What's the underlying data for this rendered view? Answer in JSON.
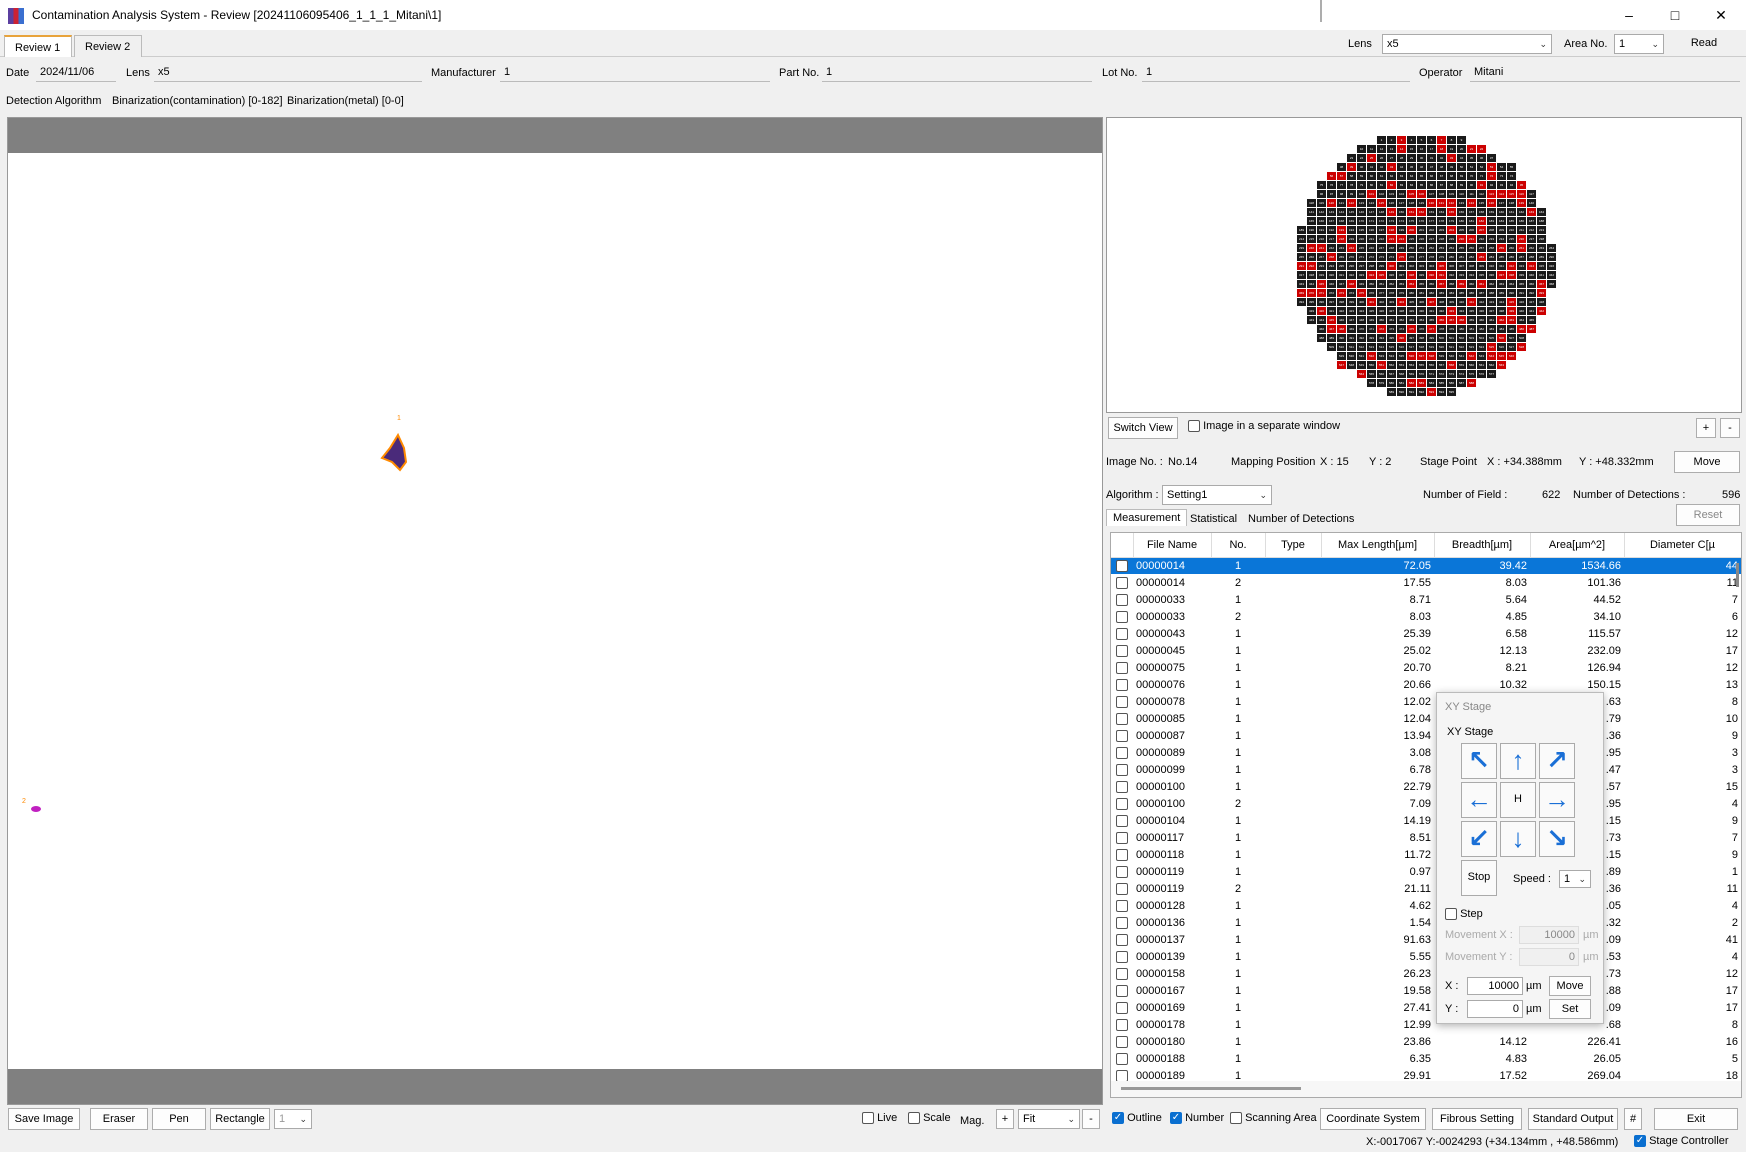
{
  "window": {
    "title": "Contamination Analysis System - Review [20241106095406_1_1_1_Mitani\\1]"
  },
  "tabs": [
    "Review 1",
    "Review 2"
  ],
  "topright": {
    "lens_label": "Lens",
    "lens_value": "x5",
    "area_label": "Area No.",
    "area_value": "1",
    "read_label": "Read"
  },
  "info": {
    "date_label": "Date",
    "date": "2024/11/06",
    "lens_label": "Lens",
    "lens": "x5",
    "manufacturer_label": "Manufacturer",
    "manufacturer": "1",
    "partno_label": "Part No.",
    "partno": "1",
    "lotno_label": "Lot No.",
    "lotno": "1",
    "operator_label": "Operator",
    "operator": "Mitani"
  },
  "detection": {
    "label": "Detection Algorithm",
    "value1": "Binarization(contamination) [0-182]",
    "value2": "Binarization(metal) [0-0]"
  },
  "image": {
    "particle1_label": "1",
    "particle2_label": "2"
  },
  "mapctrl": {
    "switch_view": "Switch View",
    "separate_window": "Image in a separate window",
    "plus": "+",
    "minus": "-"
  },
  "position": {
    "image_no_label": "Image No. :",
    "image_no": "No.14",
    "mapping_label": "Mapping Position",
    "mapping_x": "X : 15",
    "mapping_y": "Y : 2",
    "stage_label": "Stage Point",
    "stage_x": "X : +34.388mm",
    "stage_y": "Y : +48.332mm",
    "move": "Move"
  },
  "algorithm": {
    "label": "Algorithm :",
    "value": "Setting1",
    "fields_label": "Number of Field :",
    "fields": "622",
    "detections_label": "Number of Detections :",
    "detections": "596",
    "reset": "Reset"
  },
  "subtabs": [
    "Measurement",
    "Statistical",
    "Number of Detections"
  ],
  "table": {
    "headers": [
      "File Name",
      "No.",
      "Type",
      "Max Length[µm]",
      "Breadth[µm]",
      "Area[µm^2]",
      "Diameter C[µ"
    ],
    "rows": [
      [
        "00000014",
        "1",
        "",
        "72.05",
        "39.42",
        "1534.66",
        "44"
      ],
      [
        "00000014",
        "2",
        "",
        "17.55",
        "8.03",
        "101.36",
        "11"
      ],
      [
        "00000033",
        "1",
        "",
        "8.71",
        "5.64",
        "44.52",
        "7"
      ],
      [
        "00000033",
        "2",
        "",
        "8.03",
        "4.85",
        "34.10",
        "6"
      ],
      [
        "00000043",
        "1",
        "",
        "25.39",
        "6.58",
        "115.57",
        "12"
      ],
      [
        "00000045",
        "1",
        "",
        "25.02",
        "12.13",
        "232.09",
        "17"
      ],
      [
        "00000075",
        "1",
        "",
        "20.70",
        "8.21",
        "126.94",
        "12"
      ],
      [
        "00000076",
        "1",
        "",
        "20.66",
        "10.32",
        "150.15",
        "13"
      ],
      [
        "00000078",
        "1",
        "",
        "12.02",
        "",
        ".63",
        "8"
      ],
      [
        "00000085",
        "1",
        "",
        "12.04",
        "",
        ".79",
        "10"
      ],
      [
        "00000087",
        "1",
        "",
        "13.94",
        "",
        ".36",
        "9"
      ],
      [
        "00000089",
        "1",
        "",
        "3.08",
        "",
        ".95",
        "3"
      ],
      [
        "00000099",
        "1",
        "",
        "6.78",
        "",
        ".47",
        "3"
      ],
      [
        "00000100",
        "1",
        "",
        "22.79",
        "",
        ".57",
        "15"
      ],
      [
        "00000100",
        "2",
        "",
        "7.09",
        "",
        ".95",
        "4"
      ],
      [
        "00000104",
        "1",
        "",
        "14.19",
        "",
        ".15",
        "9"
      ],
      [
        "00000117",
        "1",
        "",
        "8.51",
        "",
        ".73",
        "7"
      ],
      [
        "00000118",
        "1",
        "",
        "11.72",
        "",
        ".15",
        "9"
      ],
      [
        "00000119",
        "1",
        "",
        "0.97",
        "",
        ".89",
        "1"
      ],
      [
        "00000119",
        "2",
        "",
        "21.11",
        "",
        ".36",
        "11"
      ],
      [
        "00000128",
        "1",
        "",
        "4.62",
        "",
        ".05",
        "4"
      ],
      [
        "00000136",
        "1",
        "",
        "1.54",
        "",
        ".32",
        "2"
      ],
      [
        "00000137",
        "1",
        "",
        "91.63",
        "",
        ".09",
        "41"
      ],
      [
        "00000139",
        "1",
        "",
        "5.55",
        "",
        ".53",
        "4"
      ],
      [
        "00000158",
        "1",
        "",
        "26.23",
        "",
        ".73",
        "12"
      ],
      [
        "00000167",
        "1",
        "",
        "19.58",
        "",
        ".88",
        "17"
      ],
      [
        "00000169",
        "1",
        "",
        "27.41",
        "",
        ".09",
        "17"
      ],
      [
        "00000178",
        "1",
        "",
        "12.99",
        "",
        ".68",
        "8"
      ],
      [
        "00000180",
        "1",
        "",
        "23.86",
        "14.12",
        "226.41",
        "16"
      ],
      [
        "00000188",
        "1",
        "",
        "6.35",
        "4.83",
        "26.05",
        "5"
      ],
      [
        "00000189",
        "1",
        "",
        "29.91",
        "17.52",
        "269.04",
        "18"
      ]
    ]
  },
  "xystage": {
    "title": "XY Stage",
    "group": "XY Stage",
    "home": "H",
    "stop": "Stop",
    "speed_label": "Speed :",
    "speed": "1",
    "step_label": "Step",
    "movx_label": "Movement X :",
    "movx": "10000",
    "movy_label": "Movement Y :",
    "movy": "0",
    "unit": "µm",
    "x_label": "X :",
    "x": "10000",
    "y_label": "Y :",
    "y": "0",
    "move": "Move",
    "set": "Set"
  },
  "bottom": {
    "save_image": "Save Image",
    "eraser": "Eraser",
    "pen": "Pen",
    "rectangle": "Rectangle",
    "pen_size": "1",
    "live": "Live",
    "scale": "Scale",
    "mag": "Mag.",
    "plus": "+",
    "fit": "Fit",
    "minus": "-",
    "outline": "Outline",
    "number": "Number",
    "scanning_area": "Scanning Area",
    "coord": "Coordinate System",
    "fibrous": "Fibrous Setting",
    "std_output": "Standard Output",
    "hash": "#",
    "exit": "Exit"
  },
  "status": {
    "coords": "X:-0017067  Y:-0024293  (+34.134mm , +48.586mm)",
    "stage_ctrl": "Stage Controller"
  },
  "colors": {
    "selected": "#0a76d8",
    "accent": "#1a6fd6",
    "map_red": "#cc0000",
    "map_cell": "#1a1a1a"
  }
}
